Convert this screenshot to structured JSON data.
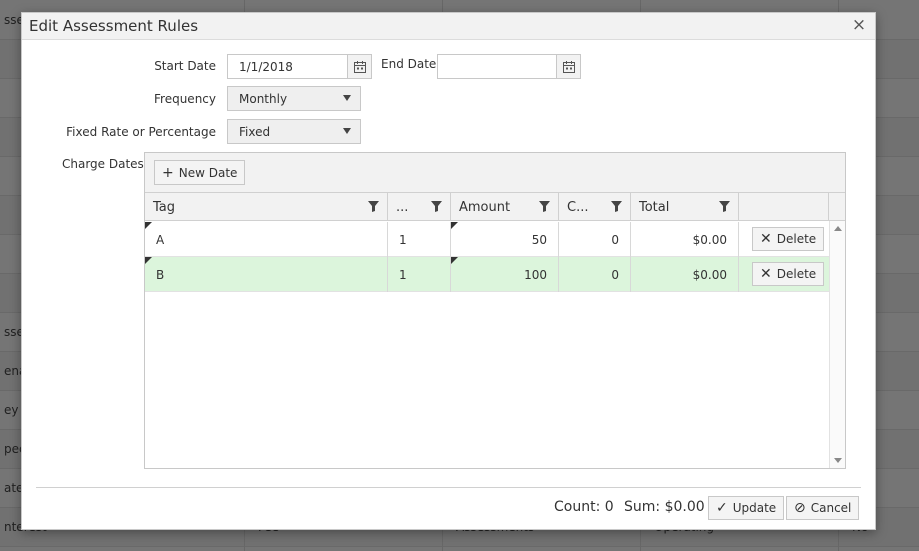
{
  "background": {
    "rows": [
      [
        "sses",
        "",
        "",
        "",
        ""
      ],
      [
        "",
        "",
        "",
        "",
        ""
      ],
      [
        "",
        "",
        "",
        "",
        ""
      ],
      [
        "",
        "",
        "",
        "",
        ""
      ],
      [
        "",
        "",
        "",
        "",
        ""
      ],
      [
        "",
        "",
        "",
        "",
        ""
      ],
      [
        "",
        "",
        "",
        "",
        ""
      ],
      [
        "",
        "",
        "",
        "",
        ""
      ],
      [
        "sses",
        "",
        "",
        "",
        ""
      ],
      [
        "enal",
        "",
        "",
        "",
        ""
      ],
      [
        "ey F",
        "",
        "",
        "",
        ""
      ],
      [
        "peci",
        "",
        "",
        "",
        ""
      ],
      [
        "ate f",
        "",
        "",
        "",
        ""
      ],
      [
        "nterest",
        "Fee",
        "Assessments",
        "Operating",
        "No"
      ]
    ]
  },
  "dialog": {
    "title": "Edit Assessment Rules",
    "close_glyph": "×",
    "start_date_label": "Start Date",
    "start_date_value": "1/1/2018",
    "end_date_label": "End Date",
    "end_date_value": "",
    "frequency_label": "Frequency",
    "frequency_value": "Monthly",
    "fixed_rate_label": "Fixed Rate or Percentage",
    "fixed_rate_value": "Fixed",
    "charge_dates_label": "Charge Dates",
    "new_date_label": "New Date",
    "columns": [
      "Tag",
      "...",
      "Amount",
      "C...",
      "Total"
    ],
    "rows": [
      {
        "tag": "A",
        "c2": "1",
        "amount": "50",
        "c4": "0",
        "total": "$0.00",
        "delete_label": "Delete"
      },
      {
        "tag": "B",
        "c2": "1",
        "amount": "100",
        "c4": "0",
        "total": "$0.00",
        "delete_label": "Delete"
      }
    ],
    "count_text": "Count: 0",
    "sum_text": "Sum: $0.00",
    "update_label": "Update",
    "cancel_label": "Cancel"
  },
  "colors": {
    "selected_row": "#dcf5dc",
    "header_bg": "#f2f2f2"
  }
}
